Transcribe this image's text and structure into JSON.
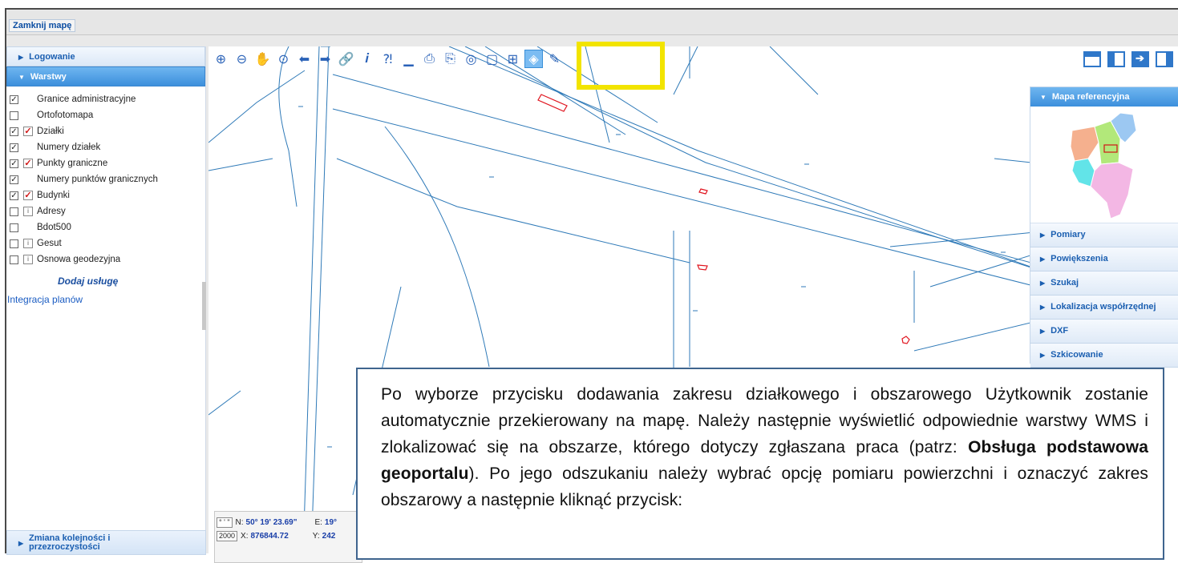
{
  "topbar": {
    "close_label": "Zamknij mapę"
  },
  "sidebar": {
    "login_label": "Logowanie",
    "layers_label": "Warstwy",
    "layers": [
      {
        "label": "Granice administracyjne",
        "checked": true,
        "icon": "none"
      },
      {
        "label": "Ortofotomapa",
        "checked": false,
        "icon": "none"
      },
      {
        "label": "Działki",
        "checked": true,
        "icon": "red-check"
      },
      {
        "label": "Numery działek",
        "checked": true,
        "icon": "none"
      },
      {
        "label": "Punkty graniczne",
        "checked": true,
        "icon": "red-check"
      },
      {
        "label": "Numery punktów granicznych",
        "checked": true,
        "icon": "none"
      },
      {
        "label": "Budynki",
        "checked": true,
        "icon": "red-check"
      },
      {
        "label": "Adresy",
        "checked": false,
        "icon": "info"
      },
      {
        "label": "Bdot500",
        "checked": false,
        "icon": "none"
      },
      {
        "label": "Gesut",
        "checked": false,
        "icon": "info"
      },
      {
        "label": "Osnowa geodezyjna",
        "checked": false,
        "icon": "info"
      }
    ],
    "add_service_label": "Dodaj usługę",
    "plans_link": "Integracja planów",
    "bottom_line1": "Zmiana kolejności i",
    "bottom_line2": "przezroczystości"
  },
  "toolbar": {
    "tools": [
      "zoom-in-icon",
      "zoom-out-icon",
      "pan-hand-icon",
      "zoom-extent-icon",
      "back-arrow-icon",
      "forward-arrow-icon",
      "link-icon",
      "info-icon",
      "query-icon",
      "measure-ruler-icon",
      "print-icon",
      "print-preview-icon",
      "globe-icon",
      "clip-icon",
      "add-parcel-range-icon",
      "add-area-range-icon",
      "pencil-icon"
    ],
    "selected_tool": "add-area-range-icon"
  },
  "right_panel": {
    "ref_map_label": "Mapa referencyjna",
    "items": [
      "Pomiary",
      "Powiększenia",
      "Szukaj",
      "Lokalizacja współrzędnej",
      "DXF",
      "Szkicowanie"
    ]
  },
  "coords": {
    "format_toggle": "° ' \"",
    "n_label": "N:",
    "n_value": "50° 19' 23.69\"",
    "e_label": "E:",
    "e_value": "19°",
    "crs_toggle": "2000",
    "x_label": "X:",
    "x_value": "876844.72",
    "y_label": "Y:",
    "y_value": "242"
  },
  "callout": {
    "text1": "Po wyborze przycisku dodawania zakresu działkowego i obszarowego Użytkownik zostanie automatycznie przekierowany na mapę. Należy następnie wyświetlić odpowiednie warstwy WMS i zlokalizować się na obszarze, którego dotyczy zgłaszana praca (patrz: ",
    "bold": "Obsługa podstawowa geoportalu",
    "text2": "). Po jego odszukaniu należy wybrać opcję pomiaru powierzchni i oznaczyć zakres obszarowy a następnie kliknąć przycisk:"
  },
  "colors": {
    "accent": "#3c8fdc",
    "highlight": "#f2e400",
    "map_lines": "#2f7ab8",
    "buildings": "#e0141e"
  }
}
